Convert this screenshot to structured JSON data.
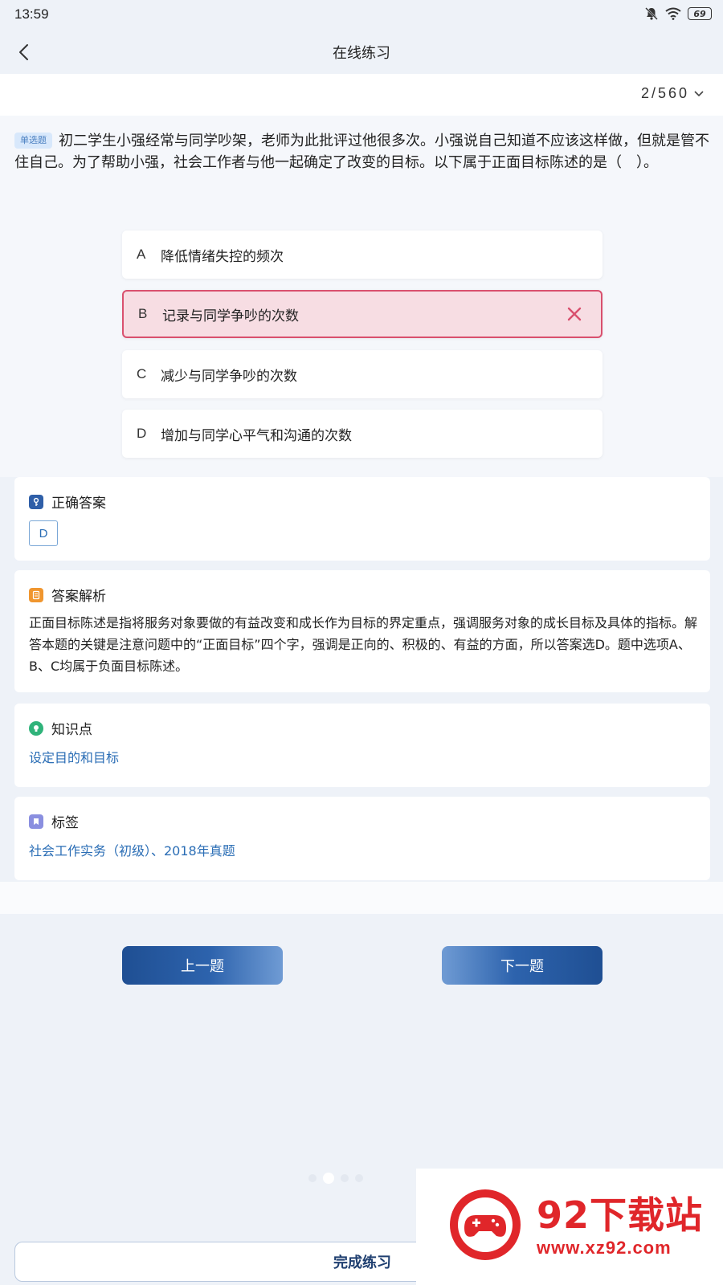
{
  "status": {
    "time": "13:59",
    "battery": "69"
  },
  "nav": {
    "title": "在线练习"
  },
  "progress": {
    "current": "2",
    "total": "560",
    "label": "2/560"
  },
  "question": {
    "type_badge": "单选题",
    "text": "初二学生小强经常与同学吵架，老师为此批评过他很多次。小强说自己知道不应该这样做，但就是管不住自己。为了帮助小强，社会工作者与他一起确定了改变的目标。以下属于正面目标陈述的是（　）。"
  },
  "options": [
    {
      "letter": "A",
      "text": "降低情绪失控的频次",
      "state": "normal"
    },
    {
      "letter": "B",
      "text": "记录与同学争吵的次数",
      "state": "wrong"
    },
    {
      "letter": "C",
      "text": "减少与同学争吵的次数",
      "state": "normal"
    },
    {
      "letter": "D",
      "text": "增加与同学心平气和沟通的次数",
      "state": "normal"
    }
  ],
  "correct": {
    "heading": "正确答案",
    "answer": "D"
  },
  "analysis": {
    "heading": "答案解析",
    "text": "正面目标陈述是指将服务对象要做的有益改变和成长作为目标的界定重点，强调服务对象的成长目标及具体的指标。解答本题的关键是注意问题中的“正面目标”四个字，强调是正向的、积极的、有益的方面，所以答案选D。题中选项A、B、C均属于负面目标陈述。"
  },
  "knowledge": {
    "heading": "知识点",
    "value": "设定目的和目标"
  },
  "tags": {
    "heading": "标签",
    "value": "社会工作实务（初级）、2018年真题"
  },
  "buttons": {
    "prev": "上一题",
    "next": "下一题",
    "finish": "完成练习"
  },
  "watermark": {
    "name": "92下载站",
    "url": "www.xz92.com"
  },
  "colors": {
    "accent": "#2a6db5",
    "wrong_border": "#d9506e",
    "wrong_bg": "#f7dde3",
    "watermark": "#e0262a"
  }
}
